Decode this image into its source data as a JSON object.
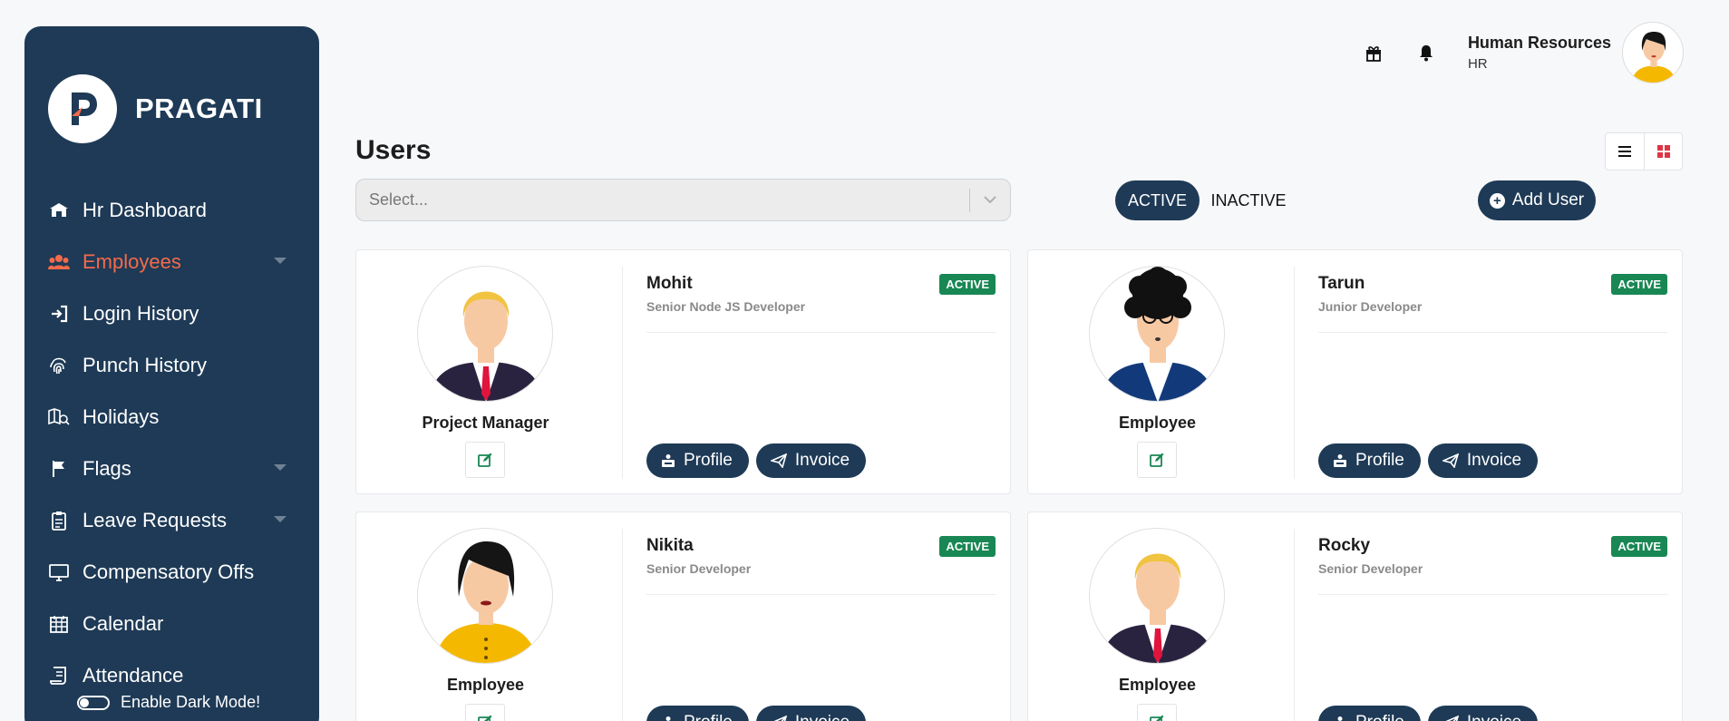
{
  "app": {
    "brand": "PRAGATI"
  },
  "sidebar": {
    "items": [
      {
        "label": "Hr Dashboard",
        "icon": "home-icon",
        "active": false,
        "dropdown": false
      },
      {
        "label": "Employees",
        "icon": "users-icon",
        "active": true,
        "dropdown": true
      },
      {
        "label": "Login History",
        "icon": "login-icon",
        "active": false,
        "dropdown": false
      },
      {
        "label": "Punch History",
        "icon": "fingerprint-icon",
        "active": false,
        "dropdown": false
      },
      {
        "label": "Holidays",
        "icon": "map-search-icon",
        "active": false,
        "dropdown": false
      },
      {
        "label": "Flags",
        "icon": "flag-icon",
        "active": false,
        "dropdown": true
      },
      {
        "label": "Leave Requests",
        "icon": "clipboard-icon",
        "active": false,
        "dropdown": true
      },
      {
        "label": "Compensatory Offs",
        "icon": "monitor-icon",
        "active": false,
        "dropdown": false
      },
      {
        "label": "Calendar",
        "icon": "calendar-icon",
        "active": false,
        "dropdown": false
      },
      {
        "label": "Attendance",
        "icon": "receipt-icon",
        "active": false,
        "dropdown": false
      }
    ],
    "dark_mode_label": "Enable Dark Mode!"
  },
  "header": {
    "user_name": "Human Resources",
    "user_role": "HR",
    "icons": [
      "gift-icon",
      "bell-icon"
    ]
  },
  "main": {
    "title": "Users",
    "select_placeholder": "Select...",
    "filter_active": "ACTIVE",
    "filter_inactive": "INACTIVE",
    "add_user_label": "Add User",
    "profile_label": "Profile",
    "invoice_label": "Invoice",
    "users": [
      {
        "name": "Mohit",
        "designation": "Senior Node JS Developer",
        "role": "Project Manager",
        "status": "ACTIVE",
        "avatar": "male-blond-suit"
      },
      {
        "name": "Tarun",
        "designation": "Junior Developer",
        "role": "Employee",
        "status": "ACTIVE",
        "avatar": "male-curly-glasses"
      },
      {
        "name": "Nikita",
        "designation": "Senior Developer",
        "role": "Employee",
        "status": "ACTIVE",
        "avatar": "female-yellow"
      },
      {
        "name": "Rocky",
        "designation": "Senior Developer",
        "role": "Employee",
        "status": "ACTIVE",
        "avatar": "male-blond-suit"
      }
    ]
  },
  "colors": {
    "sidebar": "#1e3a56",
    "active_nav": "#f46a4a",
    "badge": "#198754",
    "primary": "#1e3a56"
  }
}
